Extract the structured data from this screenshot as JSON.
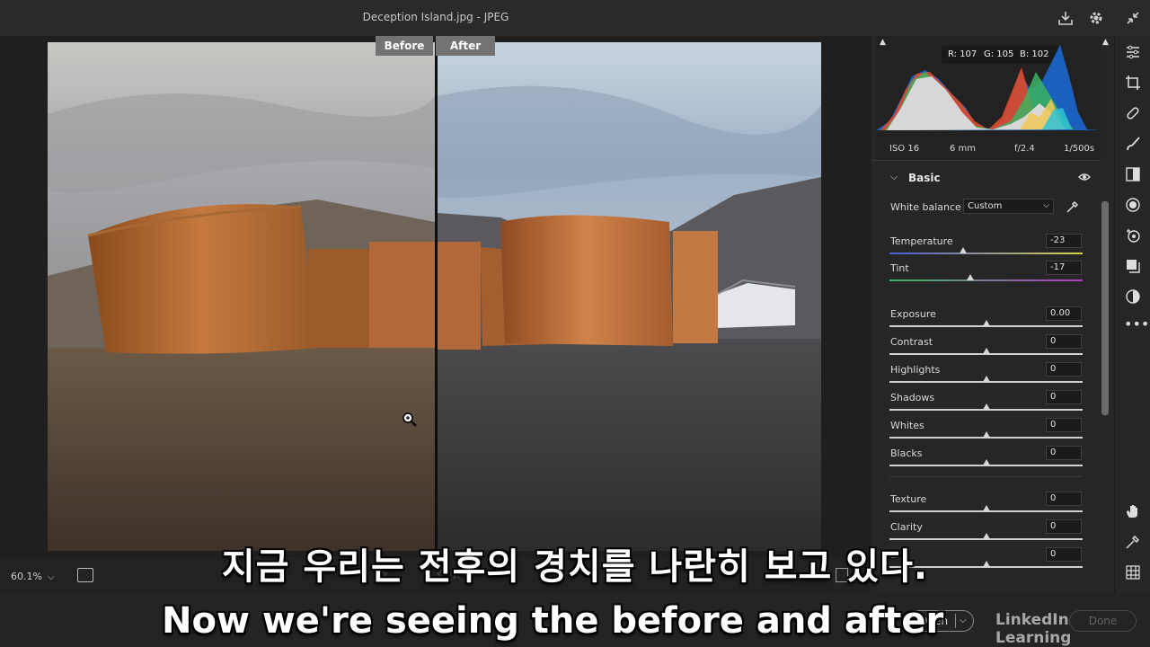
{
  "window": {
    "title": "Deception Island.jpg  -  JPEG"
  },
  "titlebar_icons": [
    "save-icon",
    "gear-icon",
    "collapse-icon"
  ],
  "compare": {
    "before_label": "Before",
    "after_label": "After"
  },
  "bottom": {
    "zoom": "60.1%"
  },
  "histogram": {
    "r_label": "R: 107",
    "g_label": "G: 105",
    "b_label": "B: 102"
  },
  "exif": {
    "iso": "ISO 16",
    "focal": "6 mm",
    "aperture": "f/2.4",
    "shutter": "1/500s"
  },
  "basic": {
    "title": "Basic",
    "white_balance_label": "White balance",
    "white_balance_value": "Custom",
    "sliders": [
      {
        "label": "Temperature",
        "value": "-23",
        "pos": 0.38
      },
      {
        "label": "Tint",
        "value": "-17",
        "pos": 0.42
      },
      {
        "label": "Exposure",
        "value": "0.00",
        "pos": 0.5
      },
      {
        "label": "Contrast",
        "value": "0",
        "pos": 0.5
      },
      {
        "label": "Highlights",
        "value": "0",
        "pos": 0.5
      },
      {
        "label": "Shadows",
        "value": "0",
        "pos": 0.5
      },
      {
        "label": "Whites",
        "value": "0",
        "pos": 0.5
      },
      {
        "label": "Blacks",
        "value": "0",
        "pos": 0.5
      },
      {
        "label": "Texture",
        "value": "0",
        "pos": 0.5
      },
      {
        "label": "Clarity",
        "value": "0",
        "pos": 0.5
      },
      {
        "label": "D",
        "value": "0",
        "pos": 0.5
      }
    ]
  },
  "footer": {
    "open_label": "Open",
    "done_label": "Done",
    "watermark": "LinkedIn Learning"
  },
  "subtitles": {
    "korean": "지금 우리는 전후의 경치를 나란히 보고 있다.",
    "english": "Now we're seeing the before and after"
  },
  "tools": [
    "edit-icon",
    "crop-icon",
    "heal-icon",
    "brush-icon",
    "gradient-icon",
    "radial-icon",
    "redeye-icon",
    "presets-icon",
    "snapshot-icon",
    "more-icon",
    "hand-icon",
    "sampler-icon",
    "grid-icon"
  ]
}
